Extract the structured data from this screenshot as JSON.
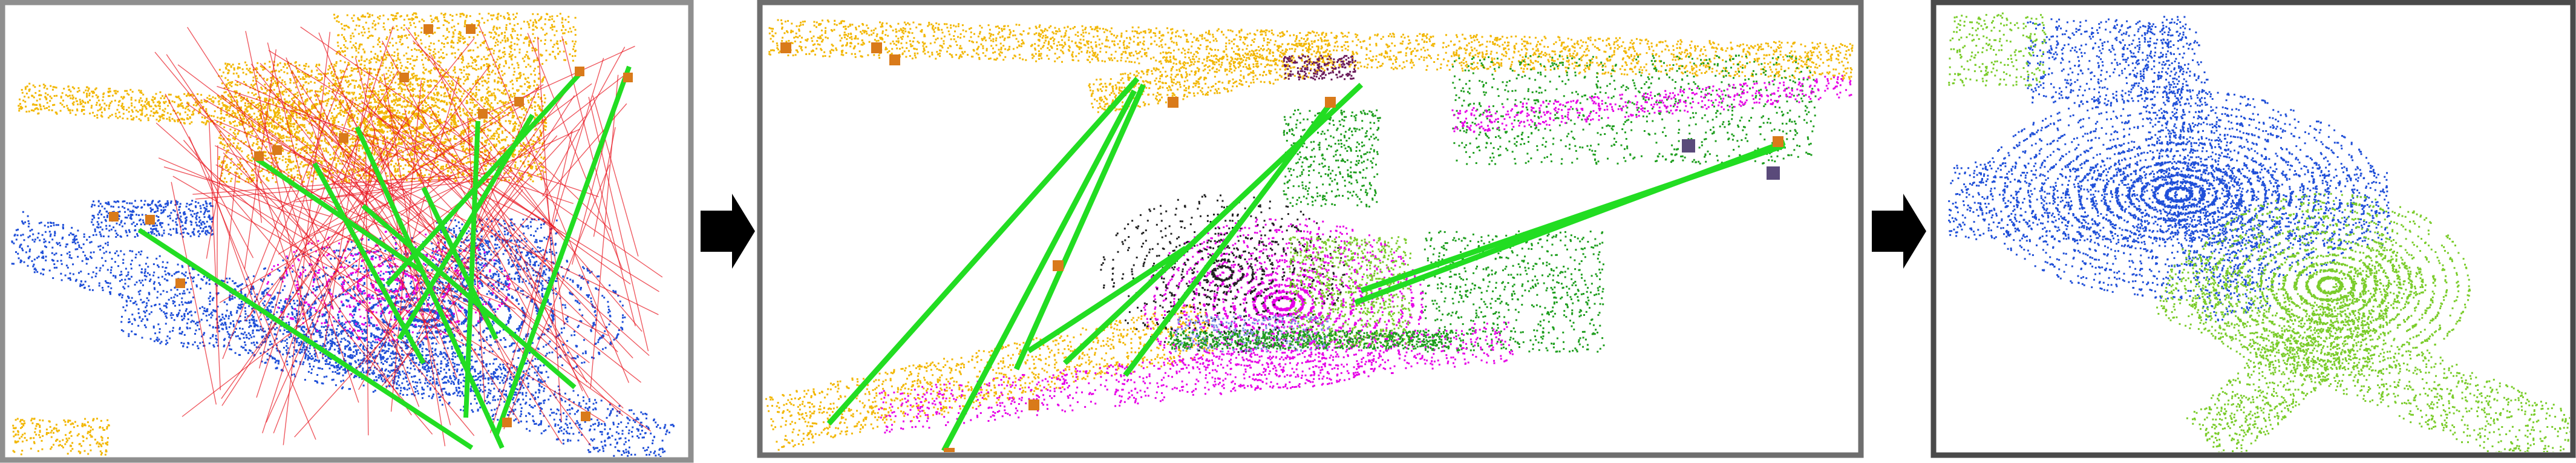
{
  "figure": {
    "panels": [
      {
        "id": "raw-correspondences",
        "frame_color": "#8f8f8f"
      },
      {
        "id": "filtered-correspondences",
        "frame_color": "#6e6e6e"
      },
      {
        "id": "registered-result",
        "frame_color": "#4a4a4a"
      }
    ],
    "arrows": [
      {
        "from": "raw-correspondences",
        "to": "filtered-correspondences",
        "icon": "right-arrow-icon",
        "color": "#000000"
      },
      {
        "from": "filtered-correspondences",
        "to": "registered-result",
        "icon": "right-arrow-icon",
        "color": "#000000"
      }
    ],
    "colors": {
      "source_cloud": "#f2b705",
      "target_cloud": "#1f4fd8",
      "inlier_line": "#22dd22",
      "outlier_line": "#e8141e",
      "semantic_vegetation": "#1e9e1e",
      "semantic_road": "#e600e6",
      "semantic_object": "#7f8fe6",
      "keypoint": "#d97a1a",
      "registered_target": "#7acc2a"
    }
  }
}
